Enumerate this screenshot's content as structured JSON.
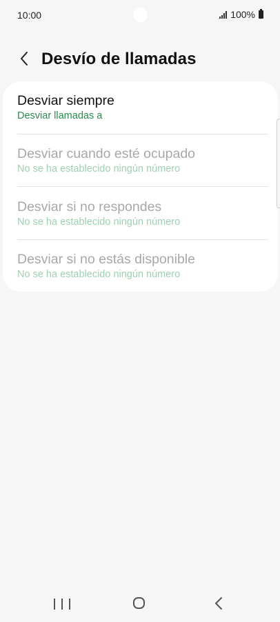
{
  "status_bar": {
    "time": "10:00",
    "battery_text": "100%"
  },
  "header": {
    "title": "Desvío de llamadas"
  },
  "items": [
    {
      "title": "Desviar siempre",
      "subtitle": "Desviar llamadas a"
    },
    {
      "title": "Desviar cuando esté ocupado",
      "subtitle": "No se ha establecido ningún número"
    },
    {
      "title": "Desviar si no respondes",
      "subtitle": "No se ha establecido ningún número"
    },
    {
      "title": "Desviar si no estás disponible",
      "subtitle": "No se ha establecido ningún número"
    }
  ],
  "colors": {
    "background": "#f6f6f6",
    "card": "#ffffff",
    "accent_green": "#2a8a4f",
    "disabled_text": "#a8a8a8",
    "disabled_green": "#9fcfb3"
  },
  "icons": {
    "back": "chevron-left-icon",
    "signal": "signal-icon",
    "battery": "battery-icon",
    "nav_recents": "recents-icon",
    "nav_home": "home-icon",
    "nav_back": "back-icon"
  }
}
